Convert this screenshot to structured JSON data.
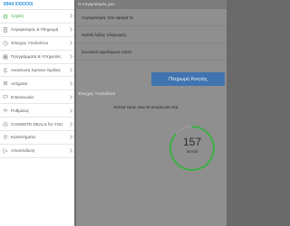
{
  "header": {
    "phone_number": "6944 XXXXXX"
  },
  "sidebar": {
    "items": [
      {
        "label": "Αρχική",
        "icon": "home-icon",
        "active": true
      },
      {
        "label": "Λογαριασμός & Πληρωμή",
        "icon": "bill-icon"
      },
      {
        "label": "Έλεγχος Υπολοίπου",
        "icon": "balance-icon"
      },
      {
        "label": "Προγράμματα & Υπηρεσίες",
        "icon": "services-icon"
      },
      {
        "label": "Ανανέωση Χρόνου Ομιλίας",
        "icon": "refill-icon"
      },
      {
        "label": "Αιτήματα",
        "icon": "requests-icon"
      },
      {
        "label": "Επικοινωνία",
        "icon": "contact-icon"
      },
      {
        "label": "Ρυθμίσεις",
        "icon": "settings-icon"
      },
      {
        "label": "COSMOTE DEALS for YOU",
        "icon": "deals-icon"
      },
      {
        "label": "Καταστήματα",
        "icon": "stores-icon"
      },
      {
        "label": "Αποσύνδεση",
        "icon": "logout-icon"
      }
    ]
  },
  "account_section": {
    "title": "Ο Λογαριασμός μου",
    "rows": [
      "Λογαριασμός που αφορά το",
      "Ημ/νία λήξης πληρωμής:",
      "Συνολικό οφειλόμενο ποσό:"
    ],
    "pay_button": "Πληρωμή Κινητής"
  },
  "balance_section": {
    "title": "Έλεγχος Υπολοίπου",
    "usage_text": "Λεπτά προς όλα τα κινητά και στα",
    "minutes_value": "157",
    "minutes_unit": "λεπτά"
  },
  "colors": {
    "active_green": "#3cb043",
    "phone_blue": "#2b8ed8",
    "button_blue": "#3f74b0",
    "gauge_green": "#3cb043"
  }
}
